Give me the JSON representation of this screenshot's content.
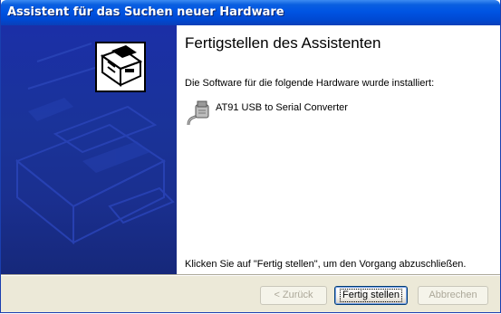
{
  "window": {
    "title": "Assistent für das Suchen neuer Hardware"
  },
  "main": {
    "heading": "Fertigstellen des Assistenten",
    "intro": "Die Software für die folgende Hardware wurde installiert:",
    "device": {
      "icon": "usb-plug-icon",
      "name": "AT91 USB to Serial Converter"
    },
    "finish_hint": "Klicken Sie auf \"Fertig stellen\", um den Vorgang abzuschließen."
  },
  "buttons": {
    "back": "< Zurück",
    "finish": "Fertig stellen",
    "cancel": "Abbrechen"
  },
  "colors": {
    "titlebar": "#0054e3",
    "side_panel": "#1a3399",
    "button_bar": "#ece9d8"
  }
}
